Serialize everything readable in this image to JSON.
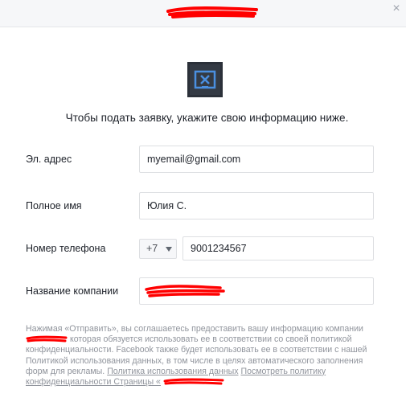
{
  "dialog": {
    "close_symbol": "×"
  },
  "logo": {
    "icon": "form-logo-icon"
  },
  "prompt_text": "Чтобы подать заявку, укажите свою информацию ниже.",
  "form": {
    "email_label": "Эл. адрес",
    "email_value": "myemail@gmail.com",
    "fullname_label": "Полное имя",
    "fullname_value": "Юлия С.",
    "phone_label": "Номер телефона",
    "phone_country_code": "+7",
    "phone_value": "9001234567",
    "company_label": "Название компании",
    "company_value": ""
  },
  "disclaimer": {
    "part1": "Нажимая «Отправить», вы соглашаетесь предоставить вашу информацию компании",
    "part2": "которая обязуется использовать ее в соответствии со своей политикой конфиденциальности. Facebook также будет использовать ее в соответствии с нашей Политикой использования данных, в том числе в целях автоматического заполнения форм для рекламы.",
    "data_policy_link": "Политика использования данных",
    "page_privacy_link": "Посмотреть политику конфиденциальности Страницы «"
  },
  "colors": {
    "redaction": "#ff0000",
    "header_bg": "#f6f7f9",
    "text": "#1d2129",
    "muted": "#90949c",
    "logo_accent": "#4a8fe0"
  }
}
